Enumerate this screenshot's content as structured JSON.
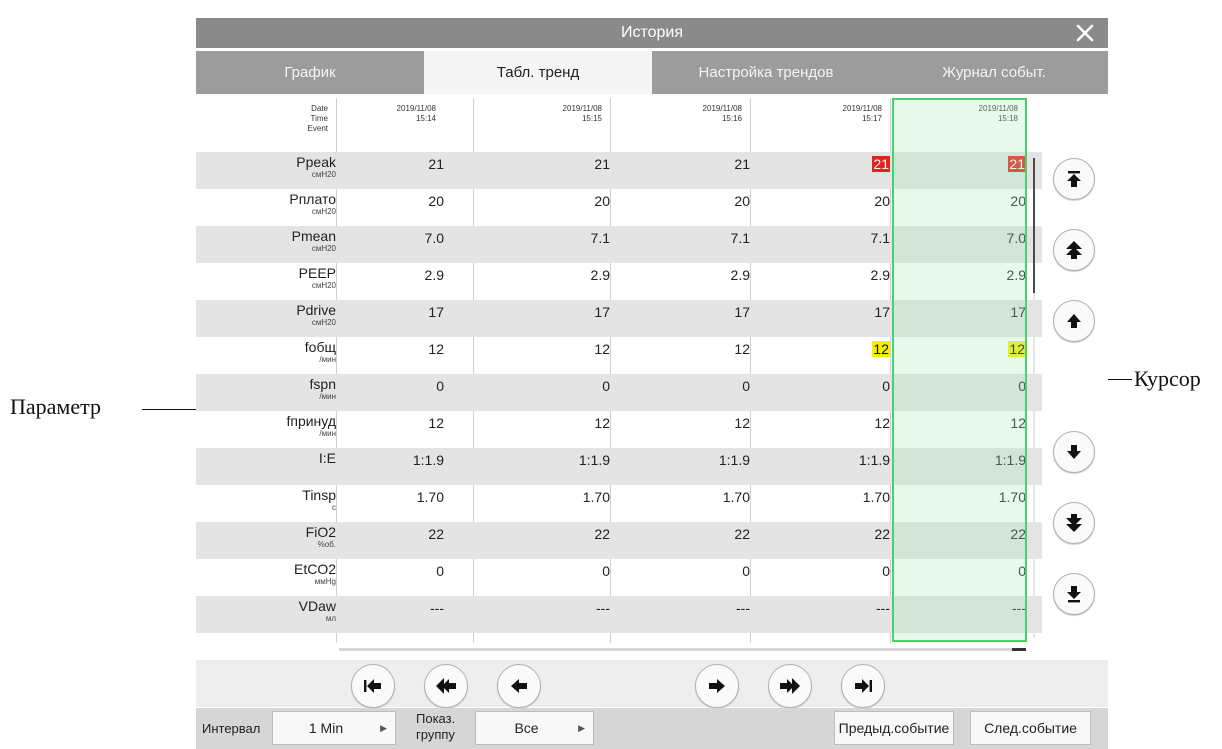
{
  "window": {
    "title": "История"
  },
  "tabs": [
    {
      "label": "График"
    },
    {
      "label": "Табл. тренд"
    },
    {
      "label": "Настройка трендов"
    },
    {
      "label": "Журнал событ."
    }
  ],
  "table": {
    "header_labels": {
      "date": "Date",
      "time": "Time",
      "event": "Event"
    },
    "columns": [
      {
        "date": "2019/11/08",
        "time": "15:14"
      },
      {
        "date": "2019/11/08",
        "time": "15:15"
      },
      {
        "date": "2019/11/08",
        "time": "15:16"
      },
      {
        "date": "2019/11/08",
        "time": "15:17"
      },
      {
        "date": "2019/11/08",
        "time": "15:18"
      }
    ],
    "selected_column": 4,
    "rows": [
      {
        "name": "Ppeak",
        "unit": "смН20",
        "values": [
          "21",
          "21",
          "21",
          "21",
          "21"
        ],
        "highlight": [
          null,
          null,
          null,
          "red",
          "red"
        ]
      },
      {
        "name": "Pплато",
        "unit": "смН20",
        "values": [
          "20",
          "20",
          "20",
          "20",
          "20"
        ],
        "highlight": [
          null,
          null,
          null,
          null,
          null
        ]
      },
      {
        "name": "Pmean",
        "unit": "смН20",
        "values": [
          "7.0",
          "7.1",
          "7.1",
          "7.1",
          "7.0"
        ],
        "highlight": [
          null,
          null,
          null,
          null,
          null
        ]
      },
      {
        "name": "PEEP",
        "unit": "смН20",
        "values": [
          "2.9",
          "2.9",
          "2.9",
          "2.9",
          "2.9"
        ],
        "highlight": [
          null,
          null,
          null,
          null,
          null
        ]
      },
      {
        "name": "Pdrive",
        "unit": "смН20",
        "values": [
          "17",
          "17",
          "17",
          "17",
          "17"
        ],
        "highlight": [
          null,
          null,
          null,
          null,
          null
        ]
      },
      {
        "name": "fобщ",
        "unit": "/мин",
        "values": [
          "12",
          "12",
          "12",
          "12",
          "12"
        ],
        "highlight": [
          null,
          null,
          null,
          "yellow",
          "yellow"
        ]
      },
      {
        "name": "fspn",
        "unit": "/мин",
        "values": [
          "0",
          "0",
          "0",
          "0",
          "0"
        ],
        "highlight": [
          null,
          null,
          null,
          null,
          null
        ]
      },
      {
        "name": "fпринуд",
        "unit": "/мин",
        "values": [
          "12",
          "12",
          "12",
          "12",
          "12"
        ],
        "highlight": [
          null,
          null,
          null,
          null,
          null
        ]
      },
      {
        "name": "I:E",
        "unit": "",
        "values": [
          "1:1.9",
          "1:1.9",
          "1:1.9",
          "1:1.9",
          "1:1.9"
        ],
        "highlight": [
          null,
          null,
          null,
          null,
          null
        ]
      },
      {
        "name": "Tinsp",
        "unit": "с",
        "values": [
          "1.70",
          "1.70",
          "1.70",
          "1.70",
          "1.70"
        ],
        "highlight": [
          null,
          null,
          null,
          null,
          null
        ]
      },
      {
        "name": "FiO2",
        "unit": "%об.",
        "values": [
          "22",
          "22",
          "22",
          "22",
          "22"
        ],
        "highlight": [
          null,
          null,
          null,
          null,
          null
        ]
      },
      {
        "name": "EtCO2",
        "unit": "ммHg",
        "values": [
          "0",
          "0",
          "0",
          "0",
          "0"
        ],
        "highlight": [
          null,
          null,
          null,
          null,
          null
        ]
      },
      {
        "name": "VDaw",
        "unit": "мл",
        "values": [
          "---",
          "---",
          "---",
          "---",
          "---"
        ],
        "highlight": [
          null,
          null,
          null,
          null,
          null
        ]
      }
    ]
  },
  "footer": {
    "interval_label": "Интервал",
    "interval_value": "1 Min",
    "group_label_line1": "Показ.",
    "group_label_line2": "группу",
    "group_value": "Все",
    "prev_event": "Предыд.событие",
    "next_event": "След.событие"
  },
  "callouts": {
    "parameter": "Параметр",
    "cursor": "Курсор"
  },
  "icons": {
    "close": "close-icon",
    "right_nav": [
      "jump-top-icon",
      "page-up-icon",
      "line-up-icon",
      "line-down-icon",
      "page-down-icon",
      "jump-bottom-icon"
    ],
    "bottom_nav": [
      "jump-first-icon",
      "page-left-icon",
      "step-left-icon",
      "step-right-icon",
      "page-right-icon",
      "jump-last-icon"
    ]
  },
  "colors": {
    "title_bar": "#8a8a8a",
    "tab_bar": "#9c9c9c",
    "row_shade": "#e4e4e4",
    "cursor_border": "#4cd068",
    "alarm_red": "#e8201e",
    "alarm_yellow": "#f5f000"
  }
}
